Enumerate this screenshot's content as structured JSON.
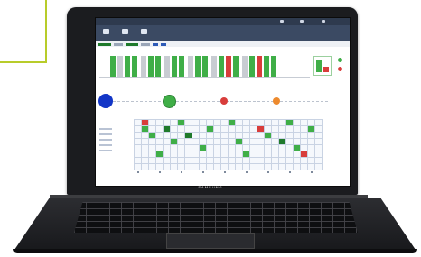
{
  "laptop": {
    "brand": "SAMSUNG"
  },
  "app": {
    "topbar": {
      "app_name": "",
      "window_title": ""
    },
    "toolbar": {
      "buttons": [
        {
          "label": "",
          "icon": "box-icon"
        },
        {
          "label": "",
          "icon": "box-icon"
        },
        {
          "label": "",
          "icon": "box-icon"
        }
      ]
    },
    "section_1_label": "",
    "section_2_label": "",
    "section_3_label": "",
    "start_node_label": "",
    "node_labels": [
      "",
      "",
      ""
    ]
  },
  "colors": {
    "success_green": "#3fae47",
    "alert_red": "#d83d3b",
    "warning_orange": "#ed8a2e",
    "primary_blue": "#1336c7",
    "accent_lime": "#b8cc2a"
  }
}
